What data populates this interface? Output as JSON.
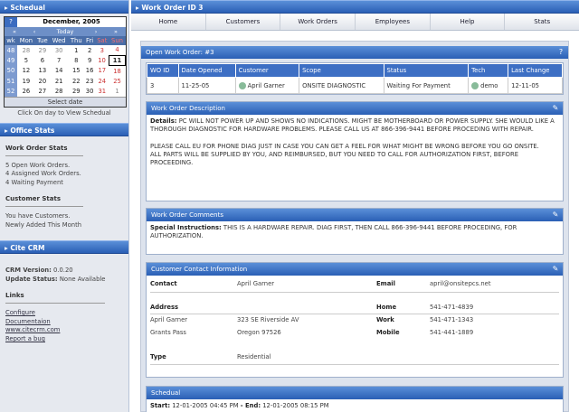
{
  "left": {
    "schedual_header": "▸ Schedual",
    "calendar": {
      "q": "?",
      "month": "December, 2005",
      "nav_prev2": "«",
      "nav_prev": "‹",
      "today": "Today",
      "nav_next": "›",
      "nav_next2": "»",
      "days": [
        "wk",
        "Mon",
        "Tue",
        "Wed",
        "Thu",
        "Fri",
        "Sat",
        "Sun"
      ],
      "weeks": [
        [
          "48",
          "28",
          "29",
          "30",
          "1",
          "2",
          "3",
          "4"
        ],
        [
          "49",
          "5",
          "6",
          "7",
          "8",
          "9",
          "10",
          "11"
        ],
        [
          "50",
          "12",
          "13",
          "14",
          "15",
          "16",
          "17",
          "18"
        ],
        [
          "51",
          "19",
          "20",
          "21",
          "22",
          "23",
          "24",
          "25"
        ],
        [
          "52",
          "26",
          "27",
          "28",
          "29",
          "30",
          "31",
          "1"
        ]
      ],
      "footer": "Select date",
      "hint": "Click On day to View Schedual"
    },
    "office_header": "▸ Office Stats",
    "wo_stats_title": "Work Order Stats",
    "wo_stats": [
      "5 Open Work Orders.",
      "4 Assigned Work Orders.",
      "4 Waiting Payment"
    ],
    "cust_stats_title": "Customer Stats",
    "cust_stats": [
      "You have Customers.",
      "Newly Added This Month"
    ],
    "crm_header": "▸ Cite CRM",
    "crm_version_label": "CRM Version:",
    "crm_version": "0.0.20",
    "update_label": "Update Status:",
    "update_value": "None Available",
    "links_title": "Links",
    "links": [
      "Configure",
      "Documentaion",
      "www.citecrm.com",
      "Report a bug"
    ]
  },
  "right": {
    "title": "▸ Work Order ID 3",
    "nav": [
      "Home",
      "Customers",
      "Work Orders",
      "Employees",
      "Help",
      "Stats"
    ],
    "open_wo": "Open Work Order: #3",
    "help_icon": "?",
    "cols": [
      "WO ID",
      "Date Opened",
      "Customer",
      "Scope",
      "Status",
      "Tech",
      "Last Change"
    ],
    "row": [
      "3",
      "11-25-05",
      "April Garner",
      "ONSITE DIAGNOSTIC",
      "Waiting For Payment",
      "demo",
      "12-11-05"
    ],
    "desc_title": "Work Order Description",
    "desc_label": "Details:",
    "desc_1": "PC WILL NOT POWER UP AND SHOWS NO INDICATIONS. MIGHT BE MOTHERBOARD OR POWER SUPPLY. SHE WOULD LIKE A THOROUGH DIAGNOSTIC FOR HARDWARE PROBLEMS. PLEASE CALL US AT 866-396-9441 BEFORE PROCEDING WITH REPAIR.",
    "desc_2": "PLEASE CALL EU FOR PHONE DIAG JUST IN CASE YOU CAN GET A FEEL FOR WHAT MIGHT BE WRONG BEFORE YOU GO ONSITE.",
    "desc_3": "ALL PARTS WILL BE SUPPLIED BY YOU, AND REIMBURSED, BUT YOU NEED TO CALL FOR AUTHORIZATION FIRST, BEFORE PROCEEDING.",
    "comm_title": "Work Order Comments",
    "comm_label": "Special Instructions:",
    "comm_text": "THIS IS A HARDWARE REPAIR. DIAG FIRST, THEN CALL 866-396-9441 BEFORE PROCEDING, FOR AUTHORIZATION.",
    "contact_title": "Customer Contact Information",
    "contact": {
      "contact_label": "Contact",
      "contact_value": "April Garner",
      "email_label": "Email",
      "email_value": "april@onsitepcs.net",
      "address_label": "Address",
      "home_label": "Home",
      "home_value": "541-471-4839",
      "addr_name": "April Garner",
      "addr_street": "323 SE Riverside AV",
      "work_label": "Work",
      "work_value": "541-471-1343",
      "addr_city": "Grants Pass",
      "addr_state": "Oregon 97526",
      "mobile_label": "Mobile",
      "mobile_value": "541-441-1889",
      "type_label": "Type",
      "type_value": "Residential"
    },
    "sched_title": "Schedual",
    "sched_start_label": "Start:",
    "sched_start": "12-01-2005 04:45 PM",
    "sched_end_label": "- End:",
    "sched_end": "12-01-2005 08:15 PM"
  }
}
